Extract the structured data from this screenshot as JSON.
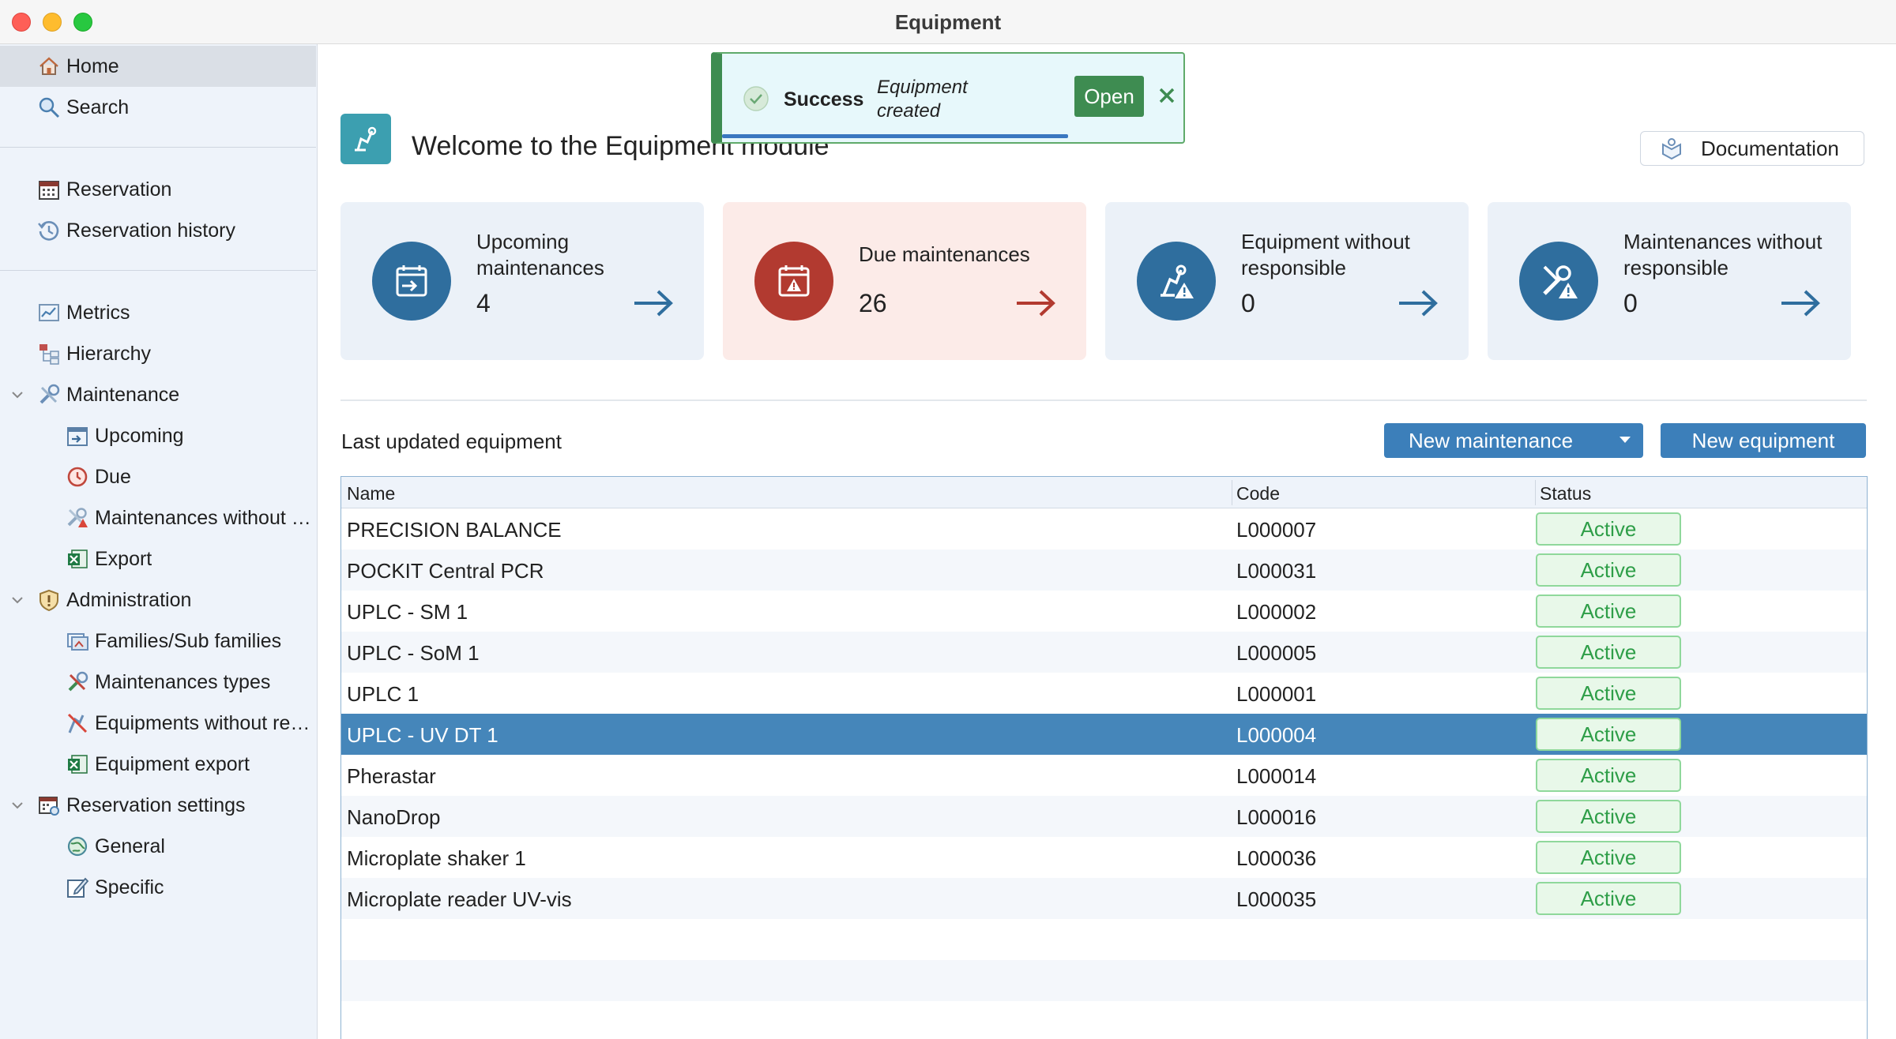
{
  "window": {
    "title": "Equipment"
  },
  "sidebar": {
    "items": [
      {
        "label": "Home"
      },
      {
        "label": "Search"
      },
      {
        "label": "Reservation"
      },
      {
        "label": "Reservation history"
      },
      {
        "label": "Metrics"
      },
      {
        "label": "Hierarchy"
      },
      {
        "label": "Maintenance"
      },
      {
        "label": "Upcoming"
      },
      {
        "label": "Due"
      },
      {
        "label": "Maintenances without responsible"
      },
      {
        "label": "Export"
      },
      {
        "label": "Administration"
      },
      {
        "label": "Families/Sub families"
      },
      {
        "label": "Maintenances types"
      },
      {
        "label": "Equipments without responsible"
      },
      {
        "label": "Equipment export"
      },
      {
        "label": "Reservation settings"
      },
      {
        "label": "General"
      },
      {
        "label": "Specific"
      }
    ]
  },
  "main": {
    "welcome": "Welcome to the Equipment module",
    "documentation_label": "Documentation",
    "cards": [
      {
        "title": "Upcoming maintenances",
        "value": "4"
      },
      {
        "title": "Due maintenances",
        "value": "26"
      },
      {
        "title": "Equipment without responsible",
        "value": "0"
      },
      {
        "title": "Maintenances without responsible",
        "value": "0"
      }
    ],
    "section_title": "Last updated equipment",
    "new_maintenance_label": "New maintenance",
    "new_equipment_label": "New equipment",
    "table": {
      "columns": [
        "Name",
        "Code",
        "Status"
      ],
      "rows": [
        {
          "name": "PRECISION BALANCE",
          "code": "L000007",
          "status": "Active"
        },
        {
          "name": "POCKIT Central PCR",
          "code": "L000031",
          "status": "Active"
        },
        {
          "name": "UPLC - SM 1",
          "code": "L000002",
          "status": "Active"
        },
        {
          "name": "UPLC - SoM 1",
          "code": "L000005",
          "status": "Active"
        },
        {
          "name": "UPLC 1",
          "code": "L000001",
          "status": "Active"
        },
        {
          "name": "UPLC - UV DT 1",
          "code": "L000004",
          "status": "Active"
        },
        {
          "name": "Pherastar",
          "code": "L000014",
          "status": "Active"
        },
        {
          "name": "NanoDrop",
          "code": "L000016",
          "status": "Active"
        },
        {
          "name": "Microplate shaker 1",
          "code": "L000036",
          "status": "Active"
        },
        {
          "name": "Microplate reader UV-vis",
          "code": "L000035",
          "status": "Active"
        }
      ],
      "selected_index": 5
    }
  },
  "toast": {
    "title": "Success",
    "message": "Equipment created",
    "open_label": "Open"
  },
  "colors": {
    "accent": "#3c7fba",
    "selected_row": "#4586ba",
    "due_red": "#b23a30",
    "status_green": "#2e9e48",
    "toast_green": "#3e8c51"
  }
}
